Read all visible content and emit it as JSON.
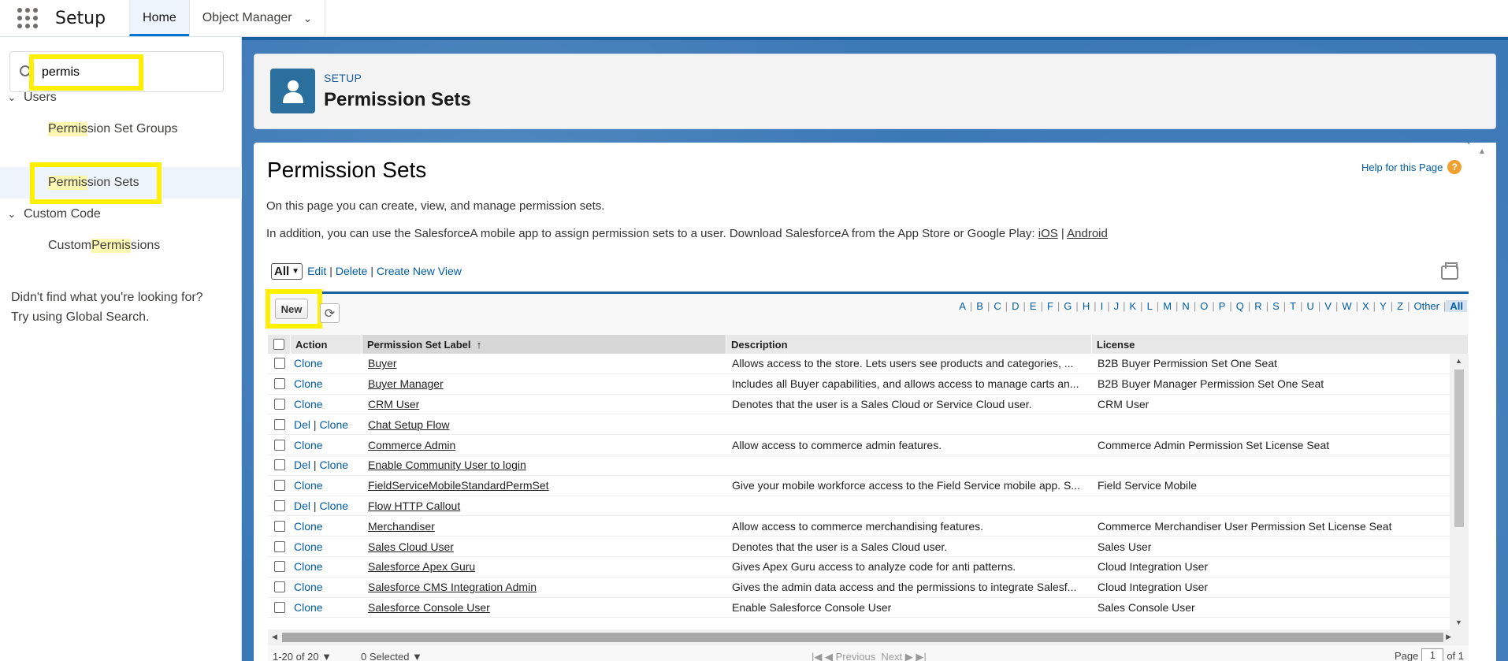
{
  "topbar": {
    "app_name": "Setup",
    "tabs": [
      {
        "label": "Home"
      },
      {
        "label": "Object Manager"
      }
    ]
  },
  "sidebar": {
    "search_value": "permis",
    "groups": [
      {
        "label": "Users"
      },
      {
        "label": "Custom Code"
      }
    ],
    "items": [
      {
        "prefix": "Permis",
        "rest": "sion Set Groups"
      },
      {
        "prefix": "Permis",
        "rest": "sion Sets"
      },
      {
        "pre": "Custom ",
        "hl": "Permis",
        "rest": "sions"
      }
    ],
    "not_found_line1": "Didn't find what you're looking for?",
    "not_found_line2": "Try using Global Search."
  },
  "header": {
    "eyebrow": "SETUP",
    "title": "Permission Sets"
  },
  "content": {
    "title": "Permission Sets",
    "help_link": "Help for this Page",
    "intro1": "On this page you can create, view, and manage permission sets.",
    "intro2_text": "In addition, you can use the SalesforceA mobile app to assign permission sets to a user. Download SalesforceA from the App Store or Google Play: ",
    "intro2_ios": "iOS",
    "intro2_sep": " | ",
    "intro2_android": "Android",
    "view_select": "All",
    "view_links": {
      "edit": "Edit",
      "delete": "Delete",
      "create": "Create New View"
    }
  },
  "list": {
    "new_button": "New",
    "alphabet": [
      "A",
      "B",
      "C",
      "D",
      "E",
      "F",
      "G",
      "H",
      "I",
      "J",
      "K",
      "L",
      "M",
      "N",
      "O",
      "P",
      "Q",
      "R",
      "S",
      "T",
      "U",
      "V",
      "W",
      "X",
      "Y",
      "Z",
      "Other"
    ],
    "alphabet_all": "All",
    "columns": {
      "action": "Action",
      "label": "Permission Set Label",
      "sort": "↑",
      "description": "Description",
      "license": "License"
    },
    "rows": [
      {
        "del": "",
        "clone": "Clone",
        "label": "Buyer",
        "description": "Allows access to the store. Lets users see products and categories, ...",
        "license": "B2B Buyer Permission Set One Seat"
      },
      {
        "del": "",
        "clone": "Clone",
        "label": "Buyer Manager",
        "description": "Includes all Buyer capabilities, and allows access to manage carts an...",
        "license": "B2B Buyer Manager Permission Set One Seat"
      },
      {
        "del": "",
        "clone": "Clone",
        "label": "CRM User",
        "description": "Denotes that the user is a Sales Cloud or Service Cloud user.",
        "license": "CRM User"
      },
      {
        "del": "Del",
        "clone": "Clone",
        "label": "Chat Setup Flow",
        "description": "",
        "license": ""
      },
      {
        "del": "",
        "clone": "Clone",
        "label": "Commerce Admin",
        "description": "Allow access to commerce admin features.",
        "license": "Commerce Admin Permission Set License Seat"
      },
      {
        "del": "Del",
        "clone": "Clone",
        "label": "Enable Community User to login",
        "description": "",
        "license": ""
      },
      {
        "del": "",
        "clone": "Clone",
        "label": "FieldServiceMobileStandardPermSet",
        "description": "Give your mobile workforce access to the Field Service mobile app. S...",
        "license": "Field Service Mobile"
      },
      {
        "del": "Del",
        "clone": "Clone",
        "label": "Flow HTTP Callout",
        "description": "",
        "license": ""
      },
      {
        "del": "",
        "clone": "Clone",
        "label": "Merchandiser",
        "description": "Allow access to commerce merchandising features.",
        "license": "Commerce Merchandiser User Permission Set License Seat"
      },
      {
        "del": "",
        "clone": "Clone",
        "label": "Sales Cloud User",
        "description": "Denotes that the user is a Sales Cloud user.",
        "license": "Sales User"
      },
      {
        "del": "",
        "clone": "Clone",
        "label": "Salesforce Apex Guru",
        "description": "Gives Apex Guru access to analyze code for anti patterns.",
        "license": "Cloud Integration User"
      },
      {
        "del": "",
        "clone": "Clone",
        "label": "Salesforce CMS Integration Admin",
        "description": "Gives the admin data access and the permissions to integrate Salesf...",
        "license": "Cloud Integration User"
      },
      {
        "del": "",
        "clone": "Clone",
        "label": "Salesforce Console User",
        "description": "Enable Salesforce Console User",
        "license": "Sales Console User"
      }
    ],
    "footer": {
      "count": "1-20 of 20",
      "selected": "0 Selected",
      "previous": "Previous",
      "next": "Next",
      "page_label": "Page",
      "page_value": "1",
      "page_of": "of 1"
    }
  }
}
